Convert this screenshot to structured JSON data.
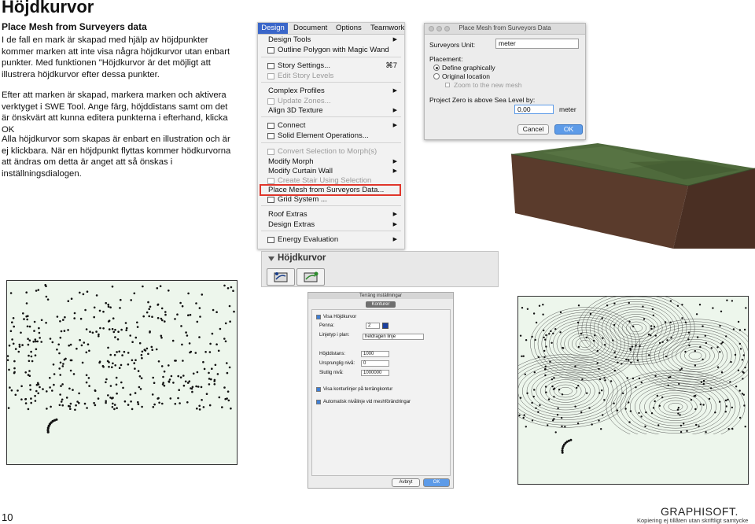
{
  "page": {
    "title": "Höjdkurvor",
    "subtitle": "Place Mesh from Surveyers data",
    "paragraphs": [
      "I de fall en mark är skapad med hjälp av höjdpunkter kommer marken att inte visa några höjdkurvor utan enbart punkter. Med funktionen \"Höjdkurvor är det möjligt att illustrera höjdkurvor efter dessa punkter.",
      "Efter att marken är skapad, markera marken och aktivera verktyget i SWE Tool. Ange färg, höjddistans samt om det är önskvärt att kunna editera punkterna i efterhand, klicka OK",
      "Alla höjdkurvor som skapas är enbart en illustration och är ej klickbara. När en höjdpunkt flyttas kommer hödkurvorna att ändras om detta är anget att så önskas i inställningsdialogen."
    ],
    "page_number": "10",
    "logo": "GRAPHISOFT.",
    "copyright": "Kopiering ej tillåten utan skriftligt samtycke"
  },
  "menu": {
    "bar": [
      "Design",
      "Document",
      "Options",
      "Teamwork"
    ],
    "items": [
      {
        "label": "Design Tools",
        "arrow": "▶",
        "disabled": false
      },
      {
        "label": "Outline Polygon with Magic Wand",
        "icon": true,
        "disabled": false
      },
      {
        "label": "Story Settings...",
        "icon": true,
        "shortcut": "⌘7",
        "disabled": false
      },
      {
        "label": "Edit Story Levels",
        "icon": true,
        "disabled": true
      },
      {
        "label": "Complex Profiles",
        "arrow": "▶",
        "disabled": false
      },
      {
        "label": "Update Zones...",
        "icon": true,
        "disabled": true
      },
      {
        "label": "Align 3D Texture",
        "arrow": "▶",
        "disabled": false
      },
      {
        "label": "Connect",
        "icon": true,
        "arrow": "▶",
        "disabled": false
      },
      {
        "label": "Solid Element Operations...",
        "icon": true,
        "disabled": false
      },
      {
        "label": "Convert Selection to Morph(s)",
        "icon": true,
        "disabled": true
      },
      {
        "label": "Modify Morph",
        "arrow": "▶",
        "disabled": false
      },
      {
        "label": "Modify Curtain Wall",
        "arrow": "▶",
        "disabled": false
      },
      {
        "label": "Create Stair Using Selection",
        "icon": true,
        "disabled": true
      },
      {
        "label": "Place Mesh from Surveyors Data...",
        "disabled": false,
        "highlight": true
      },
      {
        "label": "Grid System ...",
        "icon": true,
        "disabled": false
      },
      {
        "label": "Roof Extras",
        "arrow": "▶",
        "disabled": false
      },
      {
        "label": "Design Extras",
        "arrow": "▶",
        "disabled": false
      },
      {
        "label": "Energy Evaluation",
        "icon": true,
        "arrow": "▶",
        "disabled": false
      }
    ]
  },
  "place_mesh": {
    "title": "Place Mesh from Surveyors Data",
    "unit_label": "Surveyors Unit:",
    "unit_value": "meter",
    "placement_label": "Placement:",
    "option_graphically": "Define graphically",
    "option_original": "Original location",
    "option_zoom": "Zoom to the new mesh",
    "zero_label": "Project Zero is above Sea Level by:",
    "zero_value": "0,00",
    "zero_unit": "meter",
    "cancel": "Cancel",
    "ok": "OK"
  },
  "toolbox": {
    "title": "Höjdkurvor"
  },
  "terrang": {
    "title": "Terräng inställningar",
    "tab": "Konturer",
    "show_contours": "Visa Höjdkurvor",
    "pen_label": "Penna:",
    "pen_value": "2",
    "linetype_label": "Linjetyp i plan:",
    "linetype_value": "heldragen linje",
    "distance_label": "Höjddistans:",
    "distance_value": "1000",
    "start_label": "Ursprunglig nivå:",
    "start_value": "0",
    "end_label": "Slutlig nivå:",
    "end_value": "1000000",
    "show_on_contour": "Visa konturlinjer på terrängkontur",
    "auto_level": "Automatisk nivålinje vid meshförändringar",
    "cancel": "Avbryt",
    "ok": "OK"
  },
  "colors": {
    "accent": "#3a66c9",
    "highlight_border": "#e0362b",
    "plot_bg": "#edf6ec",
    "terrain_top": "#4f6a3c",
    "terrain_side": "#5a3b2c"
  }
}
